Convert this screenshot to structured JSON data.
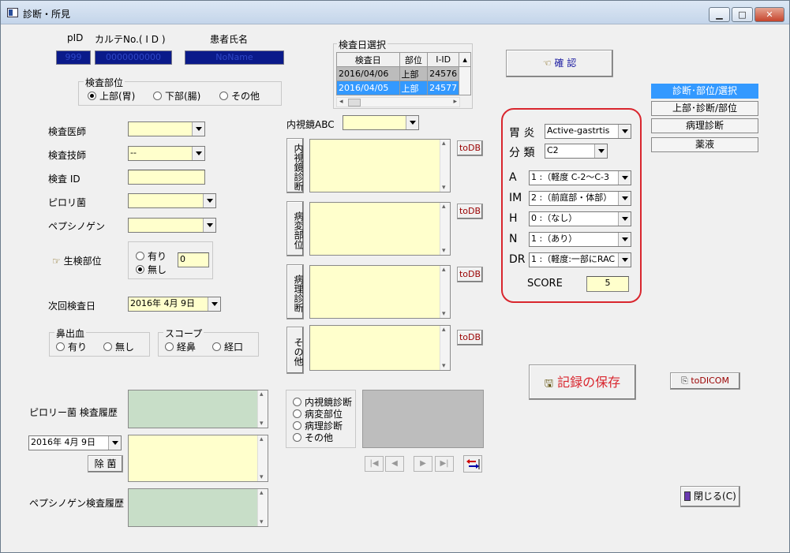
{
  "window": {
    "title": "診断・所見",
    "min_label": "▁",
    "max_label": "□",
    "close_label": "✕"
  },
  "patient": {
    "pid_label": "pID",
    "karte_label": "カルテNo.( I D )",
    "name_label": "患者氏名",
    "pid_value": "999",
    "karte_value": "0000000000",
    "name_value": "NoName"
  },
  "exam_site": {
    "legend": "検査部位",
    "options": [
      "上部(胃)",
      "下部(腸)",
      "その他"
    ],
    "selected": "上部(胃)"
  },
  "form": {
    "doctor_label": "検査医師",
    "doctor_value": "",
    "tech_label": "検査技師",
    "tech_value": "--",
    "exam_id_label": "検査 ID",
    "exam_id_value": "",
    "pylori_label": "ピロリ菌",
    "pylori_value": "",
    "pepsinogen_label": "ペプシノゲン",
    "pepsinogen_value": "",
    "biopsy_label": "生検部位",
    "biopsy_yes": "有り",
    "biopsy_no": "無し",
    "biopsy_selected": "無し",
    "biopsy_count": "0",
    "next_exam_label": "次回検査日",
    "next_exam_value": "2016年  4月  9日",
    "nosebleed_legend": "鼻出血",
    "nosebleed_yes": "有り",
    "nosebleed_no": "無し",
    "scope_legend": "スコープ",
    "scope_nasal": "経鼻",
    "scope_oral": "経口"
  },
  "history": {
    "pylori_history_label": "ピロリー菌  検査履歴",
    "date_value": "2016年  4月  9日",
    "eradication_button": "除  菌",
    "pepsinogen_history_label": "ペプシノゲン検査履歴"
  },
  "date_select": {
    "legend": "検査日選択",
    "headers": [
      "検査日",
      "部位",
      "I-ID"
    ],
    "rows": [
      {
        "date": "2016/04/06",
        "site": "上部",
        "iid": "24576"
      },
      {
        "date": "2016/04/05",
        "site": "上部",
        "iid": "24577"
      }
    ]
  },
  "abc": {
    "label": "内視鏡ABC",
    "value": ""
  },
  "findings": {
    "tabs": [
      "内視鏡診断",
      "病変部位",
      "病理診断",
      "その他"
    ],
    "todb_label": "toDB"
  },
  "image_select": {
    "options": [
      "内視鏡診断",
      "病変部位",
      "病理診断",
      "その他"
    ],
    "nav": [
      "|◀",
      "◀",
      "▶",
      "▶|"
    ]
  },
  "confirm_button": "確  認",
  "gastritis": {
    "gastritis_label": "胃  炎",
    "gastritis_value": "Active-gastrtis",
    "class_label": "分  類",
    "class_value": "C2",
    "rows": [
      {
        "key": "A",
        "value": "1 :（軽度  C-2〜C-3"
      },
      {
        "key": "IM",
        "value": "2 :（前庭部・体部）"
      },
      {
        "key": "H",
        "value": "0 :（なし）"
      },
      {
        "key": "N",
        "value": "1 :（あり）"
      },
      {
        "key": "DR",
        "value": "1 :（軽度:一部にRAC"
      }
    ],
    "score_label": "SCORE",
    "score_value": "5"
  },
  "right_nav": [
    "診断･部位/選択",
    "上部･診断/部位",
    "病理診断",
    "薬液"
  ],
  "save_button": "記録の保存",
  "todicom_button": "toDICOM",
  "close_button": "閉じる(C)",
  "colors": {
    "highlight": "#3399ff",
    "red_frame": "#d9262e",
    "navy": "#0a1a8a",
    "yellow": "#ffffcc",
    "green": "#c8dec8"
  }
}
